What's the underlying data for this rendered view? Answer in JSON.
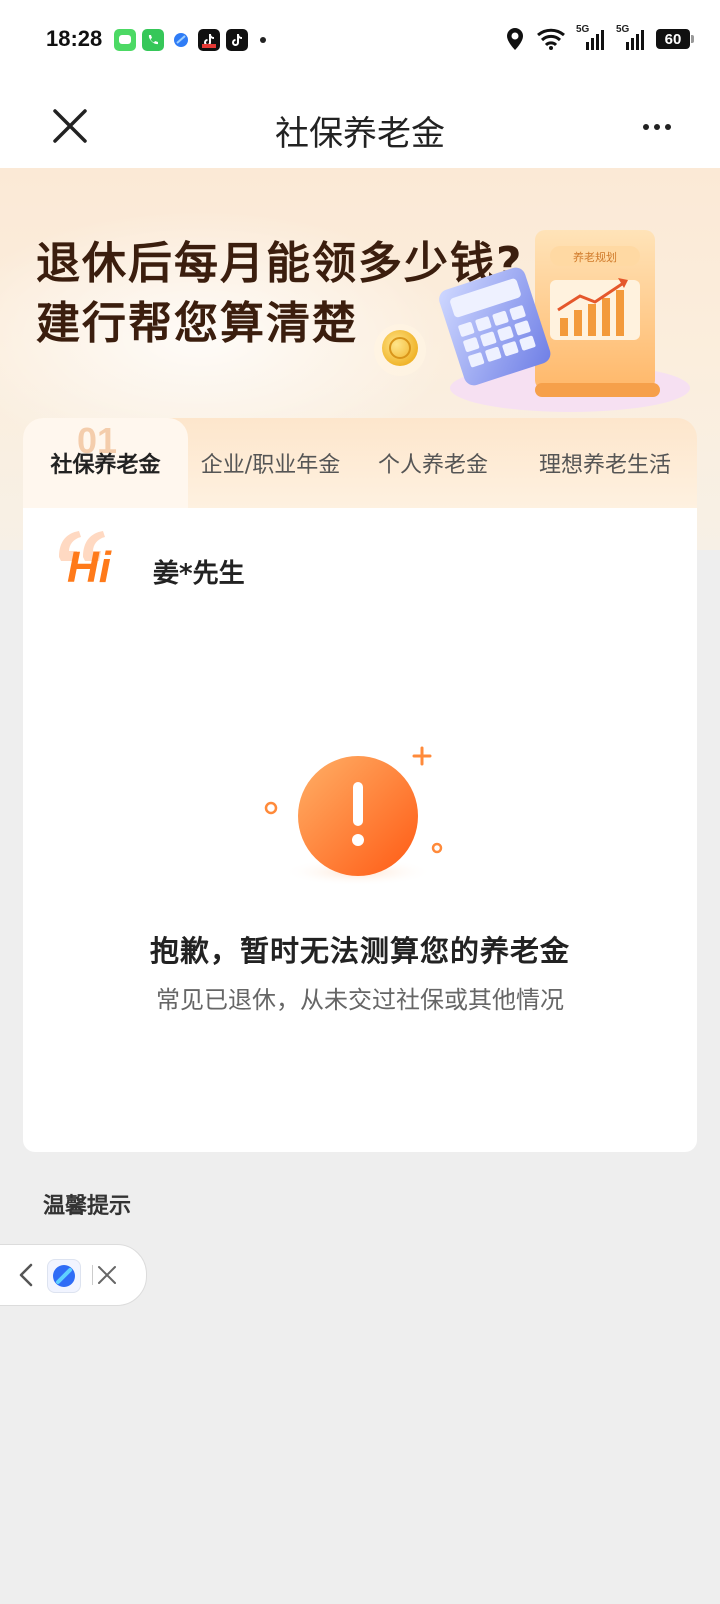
{
  "status_bar": {
    "time": "18:28",
    "battery": "60",
    "notification_icons": [
      "messages-icon",
      "phone-icon",
      "browser-icon",
      "tiktok-live-icon",
      "tiktok-icon"
    ],
    "network_label_1": "5G",
    "network_label_2": "5G"
  },
  "nav": {
    "title": "社保养老金"
  },
  "banner": {
    "headline_line1": "退休后每月能领多少钱?",
    "headline_line2": "建行帮您算清楚",
    "art_label": "养老规划"
  },
  "tabs": {
    "active_number": "01",
    "items": [
      {
        "label": "社保养老金",
        "active": true
      },
      {
        "label": "企业/职业年金",
        "active": false
      },
      {
        "label": "个人养老金",
        "active": false
      },
      {
        "label": "理想养老生活",
        "active": false
      }
    ]
  },
  "greeting": {
    "hi": "Hi",
    "user_name": "姜*先生"
  },
  "error": {
    "title": "抱歉，暂时无法测算您的养老金",
    "subtitle": "常见已退休，从未交过社保或其他情况"
  },
  "tips": {
    "title": "温馨提示"
  },
  "colors": {
    "accent_orange": "#ff7a1a",
    "headline_brown": "#3b1e0e"
  }
}
